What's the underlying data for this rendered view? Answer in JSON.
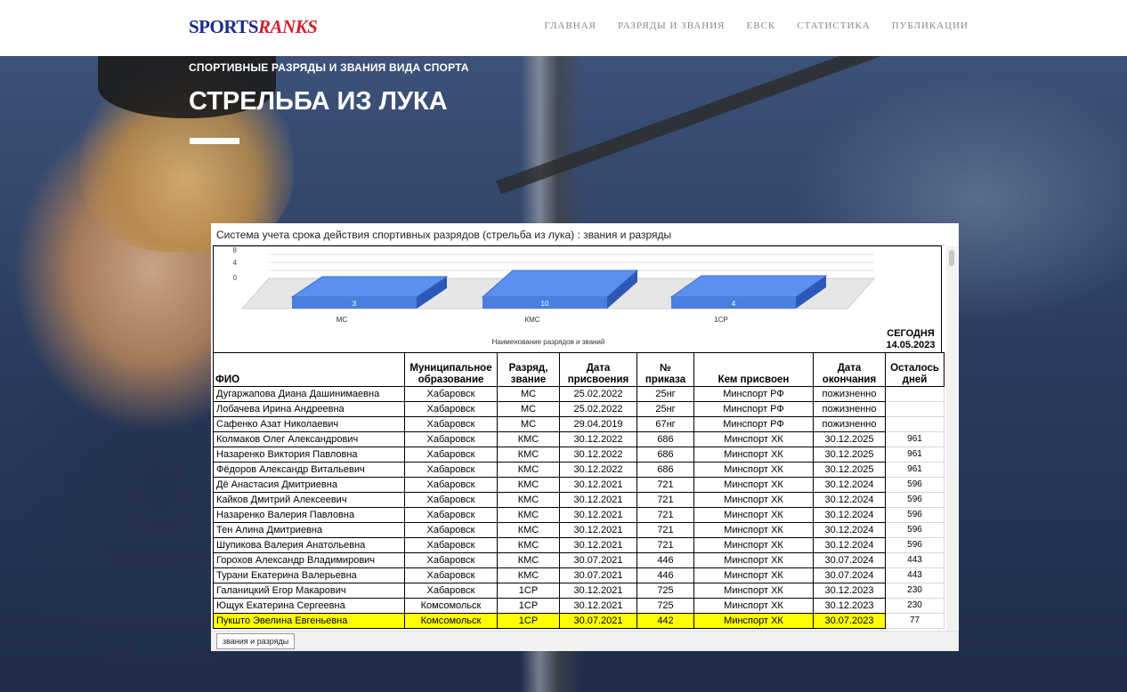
{
  "nav": {
    "logo_part1": "SPORTS",
    "logo_part2": "RANKS",
    "menu": [
      "ГЛАВНАЯ",
      "РАЗРЯДЫ И ЗВАНИЯ",
      "ЕВСК",
      "СТАТИСТИКА",
      "ПУБЛИКАЦИИ"
    ]
  },
  "hero": {
    "eyebrow": "СПОРТИВНЫЕ РАЗРЯДЫ И ЗВАНИЯ ВИДА СПОРТА",
    "title": "СТРЕЛЬБА ИЗ ЛУКА"
  },
  "sheet": {
    "title": "Система учета срока действия спортивных разрядов (стрельба из лука) : звания и разряды",
    "today_label": "СЕГОДНЯ",
    "today_date": "14.05.2023",
    "tab_label": "звания и разряды"
  },
  "chart_data": {
    "type": "bar",
    "categories": [
      "МС",
      "КМС",
      "1СР"
    ],
    "values": [
      3,
      10,
      4
    ],
    "xlabel": "Наименование разрядов и званий",
    "ylabel": "",
    "y_ticks": [
      "8",
      "4",
      "0"
    ],
    "style": "3d",
    "bar_color": "#4a7fe0"
  },
  "table": {
    "headers": {
      "fio": "ФИО",
      "mun1": "Муниципальное",
      "mun2": "образование",
      "rank1": "Разряд,",
      "rank2": "звание",
      "date1": "Дата",
      "date2": "присвоения",
      "num1": "№",
      "num2": "приказа",
      "by": "Кем присвоен",
      "end1": "Дата",
      "end2": "окончания",
      "left1": "Осталось",
      "left2": "дней"
    },
    "rows": [
      [
        "Дугаржапова Диана Дашинимаевна",
        "Хабаровск",
        "МС",
        "25.02.2022",
        "25нг",
        "Минспорт РФ",
        "пожизненно",
        ""
      ],
      [
        "Лобачева Ирина Андреевна",
        "Хабаровск",
        "МС",
        "25.02.2022",
        "25нг",
        "Минспорт РФ",
        "пожизненно",
        ""
      ],
      [
        "Сафенко Азат Николаевич",
        "Хабаровск",
        "МС",
        "29.04.2019",
        "67нг",
        "Минспорт РФ",
        "пожизненно",
        ""
      ],
      [
        "Колмаков Олег Александрович",
        "Хабаровск",
        "КМС",
        "30.12.2022",
        "686",
        "Минспорт ХК",
        "30.12.2025",
        "961"
      ],
      [
        "Назаренко Виктория Павловна",
        "Хабаровск",
        "КМС",
        "30.12.2022",
        "686",
        "Минспорт ХК",
        "30.12.2025",
        "961"
      ],
      [
        "Фёдоров Александр Витальевич",
        "Хабаровск",
        "КМС",
        "30.12.2022",
        "686",
        "Минспорт ХК",
        "30.12.2025",
        "961"
      ],
      [
        "Дё Анастасия Дмитриевна",
        "Хабаровск",
        "КМС",
        "30.12.2021",
        "721",
        "Минспорт ХК",
        "30.12.2024",
        "596"
      ],
      [
        "Кайков Дмитрий Алексеевич",
        "Хабаровск",
        "КМС",
        "30.12.2021",
        "721",
        "Минспорт ХК",
        "30.12.2024",
        "596"
      ],
      [
        "Назаренко Валерия Павловна",
        "Хабаровск",
        "КМС",
        "30.12.2021",
        "721",
        "Минспорт ХК",
        "30.12.2024",
        "596"
      ],
      [
        "Тен Алина Дмитриевна",
        "Хабаровск",
        "КМС",
        "30.12.2021",
        "721",
        "Минспорт ХК",
        "30.12.2024",
        "596"
      ],
      [
        "Шупикова Валерия Анатольевна",
        "Хабаровск",
        "КМС",
        "30.12.2021",
        "721",
        "Минспорт ХК",
        "30.12.2024",
        "596"
      ],
      [
        "Горохов Александр Владимирович",
        "Хабаровск",
        "КМС",
        "30.07.2021",
        "446",
        "Минспорт ХК",
        "30.07.2024",
        "443"
      ],
      [
        "Турани Екатерина Валерьевна",
        "Хабаровск",
        "КМС",
        "30.07.2021",
        "446",
        "Минспорт ХК",
        "30.07.2024",
        "443"
      ],
      [
        "Галаницкий Егор Макарович",
        "Хабаровск",
        "1СР",
        "30.12.2021",
        "725",
        "Минспорт ХК",
        "30.12.2023",
        "230"
      ],
      [
        "Ющук Екатерина Сергеевна",
        "Комсомольск",
        "1СР",
        "30.12.2021",
        "725",
        "Минспорт ХК",
        "30.12.2023",
        "230"
      ],
      [
        "Пукшто Эвелина Евгеньевна",
        "Комсомольск",
        "1СР",
        "30.07.2021",
        "442",
        "Минспорт ХК",
        "30.07.2023",
        "77"
      ]
    ],
    "highlight_row": 15,
    "highlight_color": "#ffff00"
  }
}
